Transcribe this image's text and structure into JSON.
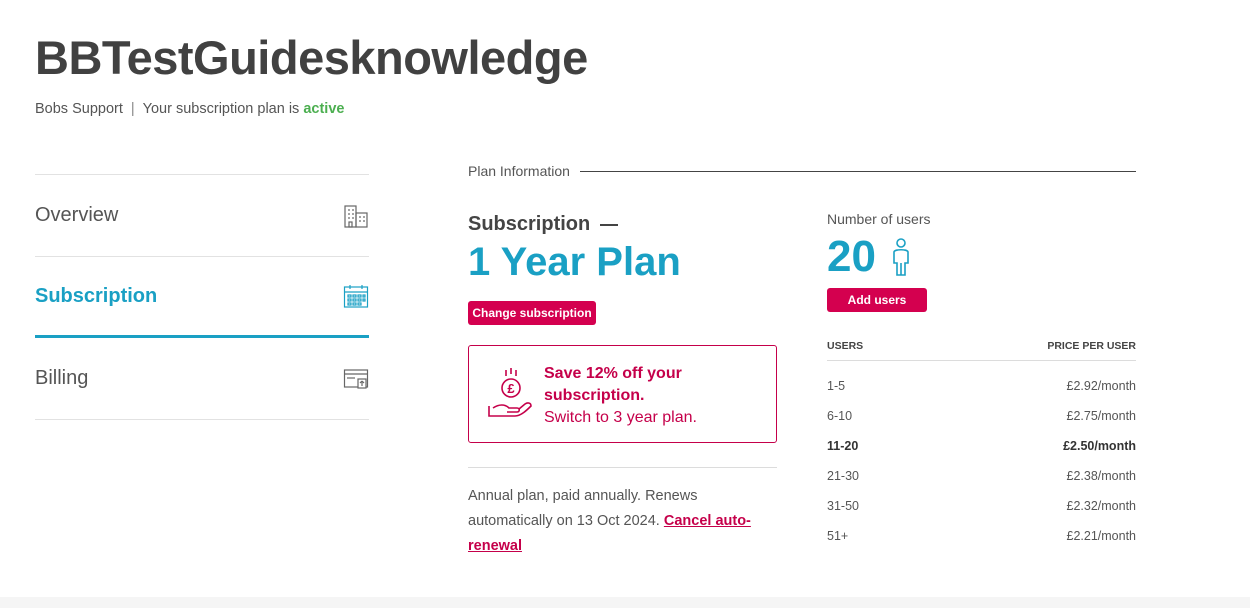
{
  "header": {
    "title": "BBTestGuidesknowledge",
    "org": "Bobs Support",
    "separator": "|",
    "status_prefix": "Your subscription plan is",
    "status": "active"
  },
  "sidebar": {
    "items": [
      {
        "label": "Overview",
        "icon": "building-icon",
        "active": false
      },
      {
        "label": "Subscription",
        "icon": "calendar-icon",
        "active": true
      },
      {
        "label": "Billing",
        "icon": "billing-icon",
        "active": false
      }
    ]
  },
  "plan": {
    "section_title": "Plan Information",
    "label": "Subscription",
    "name": "1 Year Plan",
    "change_button": "Change subscription",
    "promo": {
      "headline": "Save 12% off your subscription.",
      "subtext": "Switch to 3 year plan.",
      "icon": "pound-hand-icon"
    },
    "renew_text": "Annual plan, paid annually. Renews automatically on 13 Oct 2024.",
    "cancel_link": "Cancel auto-renewal"
  },
  "users": {
    "label": "Number of users",
    "count": "20",
    "icon": "person-icon",
    "add_button": "Add users",
    "table": {
      "col_users": "USERS",
      "col_price": "PRICE PER USER",
      "rows": [
        {
          "range": "1-5",
          "price": "£2.92/month"
        },
        {
          "range": "6-10",
          "price": "£2.75/month"
        },
        {
          "range": "11-20",
          "price": "£2.50/month"
        },
        {
          "range": "21-30",
          "price": "£2.38/month"
        },
        {
          "range": "31-50",
          "price": "£2.32/month"
        },
        {
          "range": "51+",
          "price": "£2.21/month"
        }
      ],
      "current_row": 2
    }
  },
  "colors": {
    "accent": "#1aa0c4",
    "brand_pink": "#d4004f",
    "active_green": "#4caf50"
  }
}
